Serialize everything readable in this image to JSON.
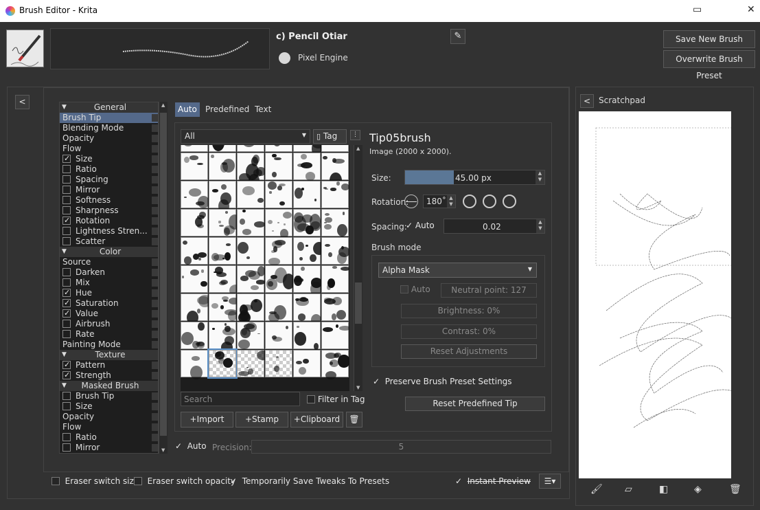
{
  "window": {
    "title": "Brush Editor - Krita",
    "restore_icon": "▭",
    "close_icon": "✕"
  },
  "preset": {
    "name": "c) Pencil Otiar",
    "engine": "Pixel Engine",
    "edit_icon": "✎"
  },
  "buttons": {
    "save_new": "Save New Brush Preset...",
    "overwrite": "Overwrite Brush Preset"
  },
  "options_list": [
    {
      "type": "header",
      "label": "General"
    },
    {
      "type": "item",
      "label": "Brush Tip",
      "selected": true
    },
    {
      "type": "item",
      "label": "Blending Mode"
    },
    {
      "type": "item",
      "label": "Opacity"
    },
    {
      "type": "item",
      "label": "Flow"
    },
    {
      "type": "check",
      "label": "Size",
      "checked": true
    },
    {
      "type": "check",
      "label": "Ratio",
      "checked": false
    },
    {
      "type": "check",
      "label": "Spacing",
      "checked": false
    },
    {
      "type": "check",
      "label": "Mirror",
      "checked": false
    },
    {
      "type": "check",
      "label": "Softness",
      "checked": false
    },
    {
      "type": "check",
      "label": "Sharpness",
      "checked": false
    },
    {
      "type": "check",
      "label": "Rotation",
      "checked": true
    },
    {
      "type": "check",
      "label": "Lightness Stren...",
      "checked": false
    },
    {
      "type": "check",
      "label": "Scatter",
      "checked": false
    },
    {
      "type": "header",
      "label": "Color"
    },
    {
      "type": "item",
      "label": "Source"
    },
    {
      "type": "check",
      "label": "Darken",
      "checked": false
    },
    {
      "type": "check",
      "label": "Mix",
      "checked": false
    },
    {
      "type": "check",
      "label": "Hue",
      "checked": true
    },
    {
      "type": "check",
      "label": "Saturation",
      "checked": true
    },
    {
      "type": "check",
      "label": "Value",
      "checked": true
    },
    {
      "type": "check",
      "label": "Airbrush",
      "checked": false
    },
    {
      "type": "check",
      "label": "Rate",
      "checked": false
    },
    {
      "type": "item",
      "label": "Painting Mode"
    },
    {
      "type": "header",
      "label": "Texture"
    },
    {
      "type": "check",
      "label": "Pattern",
      "checked": true
    },
    {
      "type": "check",
      "label": "Strength",
      "checked": true
    },
    {
      "type": "header",
      "label": "Masked Brush"
    },
    {
      "type": "check",
      "label": "Brush Tip",
      "checked": false
    },
    {
      "type": "check",
      "label": "Size",
      "checked": false
    },
    {
      "type": "item",
      "label": "Opacity"
    },
    {
      "type": "item",
      "label": "Flow"
    },
    {
      "type": "check",
      "label": "Ratio",
      "checked": false
    },
    {
      "type": "check",
      "label": "Mirror",
      "checked": false
    }
  ],
  "tip_tabs": {
    "auto": "Auto",
    "predefined": "Predefined",
    "text": "Text"
  },
  "filter": {
    "tag_select": "All",
    "tag_button": "Tag",
    "search_placeholder": "Search",
    "filter_in_tag": "Filter in Tag"
  },
  "grid_buttons": {
    "import": "Import",
    "stamp": "Stamp",
    "clipboard": "Clipboard"
  },
  "tip": {
    "name": "Tip05brush",
    "info": "Image (2000 x 2000)."
  },
  "size": {
    "label": "Size:",
    "value": "45.00 px",
    "fraction": 0.35
  },
  "rotation": {
    "label": "Rotation:",
    "value": "180˚"
  },
  "spacing": {
    "label": "Spacing:",
    "auto": "Auto",
    "value": "0.02"
  },
  "brush_mode": {
    "label": "Brush mode",
    "value": "Alpha Mask",
    "auto": "Auto",
    "neutral_point": "Neutral point: 127",
    "brightness": "Brightness: 0%",
    "contrast": "Contrast: 0%",
    "reset_adjustments": "Reset Adjustments"
  },
  "preserve": "Preserve Brush Preset Settings",
  "reset_predefined": "Reset Predefined Tip",
  "precision": {
    "auto": "Auto",
    "label": "Precision:",
    "value": "5"
  },
  "bottom": {
    "eraser_size": "Eraser switch size",
    "eraser_opacity": "Eraser switch opacity",
    "temp_save": "Temporarily Save Tweaks To Presets",
    "instant_preview": "Instant Preview"
  },
  "scratchpad": {
    "title": "Scratchpad"
  }
}
